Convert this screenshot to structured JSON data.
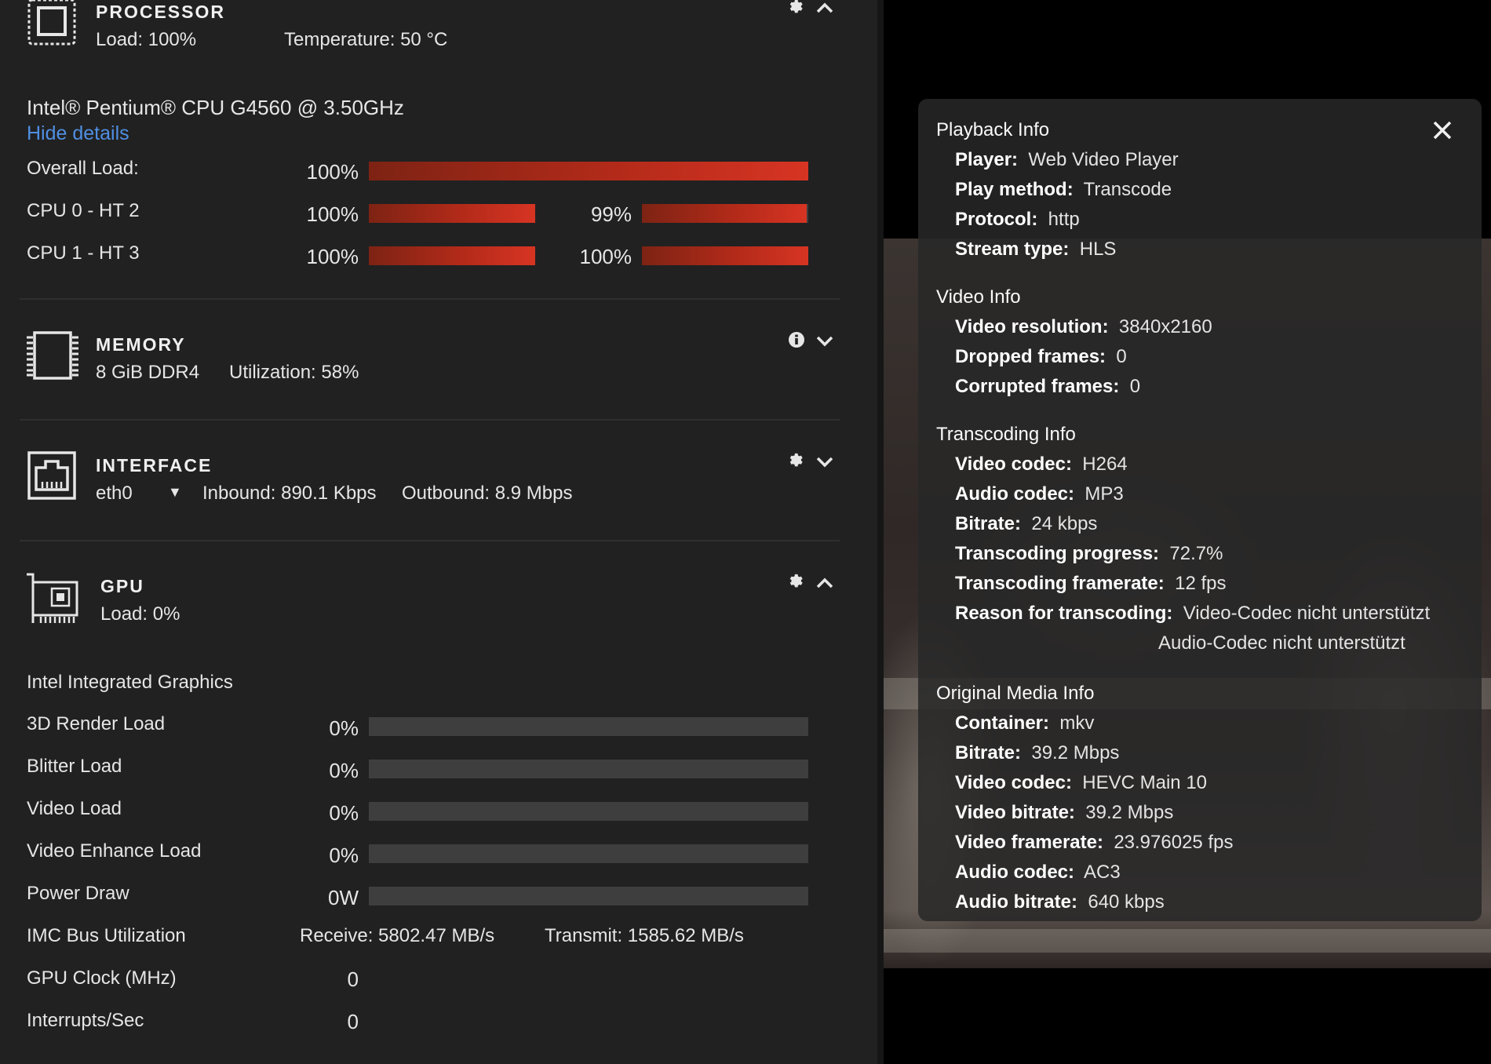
{
  "processor": {
    "title": "PROCESSOR",
    "load": "Load: 100%",
    "temperature": "Temperature: 50 °C",
    "model": "Intel® Pentium® CPU G4560 @ 3.50GHz",
    "hide_details": "Hide details",
    "overall_label": "Overall Load:",
    "overall_pct": "100%",
    "overall_value": 1.0,
    "cpus": [
      {
        "label": "CPU 0 - HT 2",
        "pct_a": "100%",
        "value_a": 1.0,
        "pct_b": "99%",
        "value_b": 0.99
      },
      {
        "label": "CPU 1 - HT 3",
        "pct_a": "100%",
        "value_a": 1.0,
        "pct_b": "100%",
        "value_b": 1.0
      }
    ]
  },
  "memory": {
    "title": "MEMORY",
    "size": "8 GiB DDR4",
    "utilization": "Utilization: 58%"
  },
  "interface": {
    "title": "INTERFACE",
    "selected": "eth0",
    "inbound": "Inbound: 890.1 Kbps",
    "outbound": "Outbound: 8.9 Mbps"
  },
  "gpu": {
    "title": "GPU",
    "load": "Load: 0%",
    "name": "Intel Integrated Graphics",
    "metrics": [
      {
        "label": "3D Render Load",
        "pct": "0%",
        "value": 0
      },
      {
        "label": "Blitter Load",
        "pct": "0%",
        "value": 0
      },
      {
        "label": "Video Load",
        "pct": "0%",
        "value": 0
      },
      {
        "label": "Video Enhance Load",
        "pct": "0%",
        "value": 0
      },
      {
        "label": "Power Draw",
        "pct": "0W",
        "value": 0
      }
    ],
    "imc_label": "IMC Bus Utilization",
    "imc_receive": "Receive: 5802.47 MB/s",
    "imc_transmit": "Transmit: 1585.62 MB/s",
    "clock_label": "GPU Clock (MHz)",
    "clock_value": "0",
    "interrupts_label": "Interrupts/Sec",
    "interrupts_value": "0"
  },
  "playback": {
    "sections": [
      {
        "title": "Playback Info",
        "rows": [
          {
            "k": "Player:",
            "v": "Web Video Player"
          },
          {
            "k": "Play method:",
            "v": "Transcode"
          },
          {
            "k": "Protocol:",
            "v": "http"
          },
          {
            "k": "Stream type:",
            "v": "HLS"
          }
        ]
      },
      {
        "title": "Video Info",
        "rows": [
          {
            "k": "Video resolution:",
            "v": "3840x2160"
          },
          {
            "k": "Dropped frames:",
            "v": "0"
          },
          {
            "k": "Corrupted frames:",
            "v": "0"
          }
        ]
      },
      {
        "title": "Transcoding Info",
        "rows": [
          {
            "k": "Video codec:",
            "v": "H264"
          },
          {
            "k": "Audio codec:",
            "v": "MP3"
          },
          {
            "k": "Bitrate:",
            "v": "24 kbps"
          },
          {
            "k": "Transcoding progress:",
            "v": "72.7%"
          },
          {
            "k": "Transcoding framerate:",
            "v": "12 fps"
          },
          {
            "k": "Reason for transcoding:",
            "v": "Video-Codec nicht unterstützt",
            "v2": "Audio-Codec nicht unterstützt"
          }
        ]
      },
      {
        "title": "Original Media Info",
        "rows": [
          {
            "k": "Container:",
            "v": "mkv"
          },
          {
            "k": "Bitrate:",
            "v": "39.2 Mbps"
          },
          {
            "k": "Video codec:",
            "v": "HEVC Main 10"
          },
          {
            "k": "Video bitrate:",
            "v": "39.2 Mbps"
          },
          {
            "k": "Video framerate:",
            "v": "23.976025 fps"
          },
          {
            "k": "Audio codec:",
            "v": "AC3"
          },
          {
            "k": "Audio bitrate:",
            "v": "640 kbps"
          }
        ]
      }
    ]
  }
}
